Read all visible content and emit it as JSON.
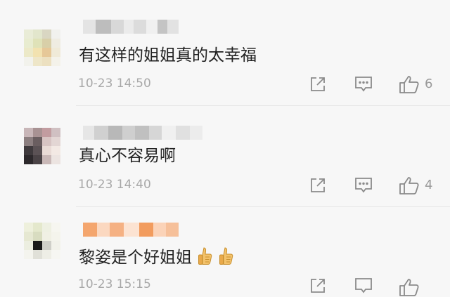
{
  "comments": [
    {
      "text": "有这样的姐姐真的太幸福",
      "time": "10-23 14:50",
      "likes": "6",
      "emoji_count": 0
    },
    {
      "text": "真心不容易啊",
      "time": "10-23 14:40",
      "likes": "4",
      "emoji_count": 0
    },
    {
      "text": "黎姿是个好姐姐",
      "time": "10-23 15:15",
      "likes": "",
      "emoji_count": 2
    }
  ],
  "icons": {
    "share": "share-icon",
    "reply": "comment-icon",
    "like": "thumbs-up-icon",
    "emoji": "thumbs-up-emoji"
  },
  "colors": {
    "text": "#222222",
    "meta": "#a8a8a8",
    "icon": "#8a8a8a",
    "background": "#f7f7f7"
  }
}
